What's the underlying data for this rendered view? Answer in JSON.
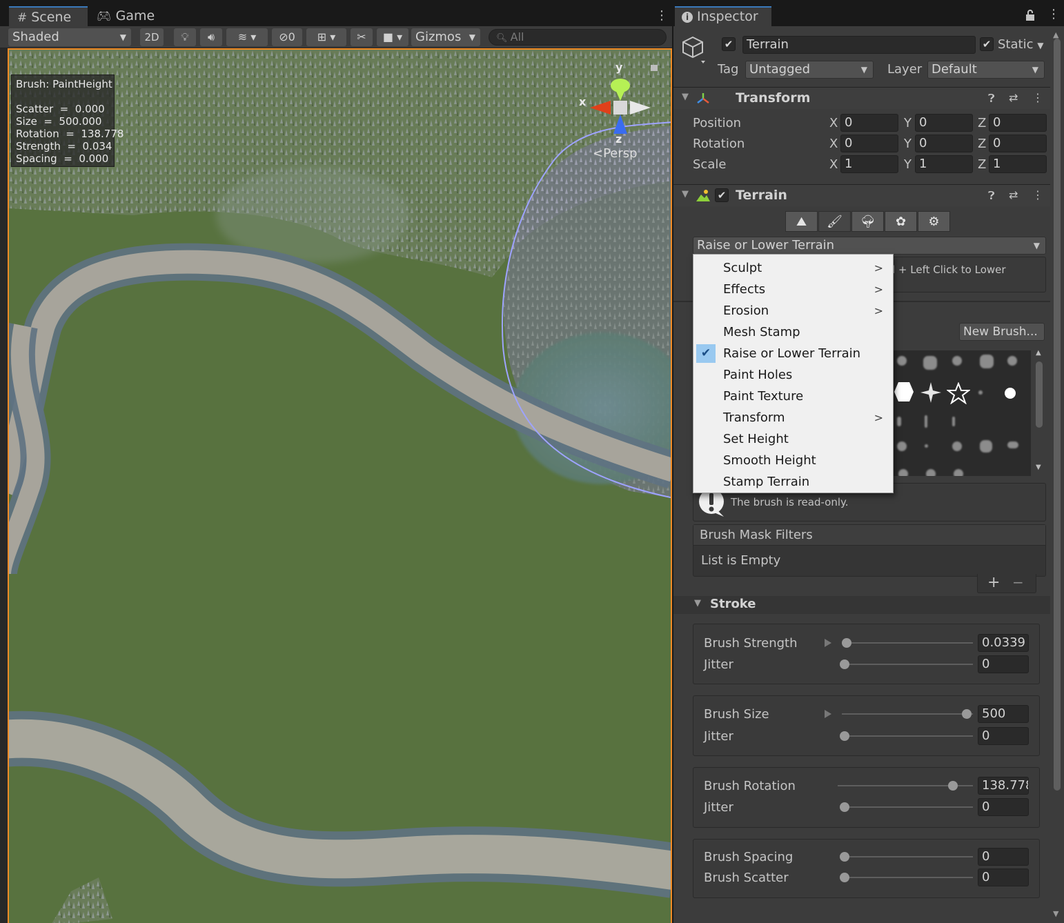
{
  "scene": {
    "tabs": {
      "scene_label": "Scene",
      "game_label": "Game"
    },
    "toolbar": {
      "shading_mode": "Shaded",
      "mode_2d": "2D",
      "hidden_count": "0",
      "gizmos_label": "Gizmos",
      "search_placeholder": "All"
    },
    "brush_overlay": {
      "brush": "Brush: PaintHeight",
      "scatter": "Scatter  =  0.000",
      "size": "Size  =  500.000",
      "rotation": "Rotation  =  138.778",
      "strength": "Strength  =  0.034",
      "spacing": "Spacing  =  0.000"
    },
    "gizmo": {
      "x": "x",
      "y": "y",
      "z": "z",
      "projection": "Persp"
    },
    "colors": {
      "selection_outline": "#f08a24",
      "grass": "#5b7646",
      "road": "#a7a49b",
      "water": "#607a82"
    }
  },
  "inspector": {
    "tab_label": "Inspector",
    "object": {
      "name": "Terrain",
      "active": true,
      "static_label": "Static",
      "static_checked": true,
      "tag_label": "Tag",
      "tag_value": "Untagged",
      "layer_label": "Layer",
      "layer_value": "Default"
    },
    "transform": {
      "title": "Transform",
      "rows": [
        {
          "label": "Position",
          "x": "0",
          "y": "0",
          "z": "0"
        },
        {
          "label": "Rotation",
          "x": "0",
          "y": "0",
          "z": "0"
        },
        {
          "label": "Scale",
          "x": "1",
          "y": "1",
          "z": "1"
        }
      ],
      "axis": {
        "x": "X",
        "y": "Y",
        "z": "Z"
      }
    },
    "terrain": {
      "title": "Terrain",
      "enabled": true,
      "tool_dropdown": "Raise or Lower Terrain",
      "help_text": "l + Left Click to Lower",
      "new_brush_label": "New Brush...",
      "brush_readonly": "The brush is read-only.",
      "mask_filters_title": "Brush Mask Filters",
      "mask_filters_empty": "List is Empty",
      "add_label": "+",
      "remove_label": "−"
    },
    "stroke": {
      "title": "Stroke",
      "brush_strength_label": "Brush Strength",
      "brush_strength_value": "0.0339",
      "brush_strength_fraction": 0.034,
      "strength_jitter_label": "Jitter",
      "strength_jitter_value": "0",
      "brush_size_label": "Brush Size",
      "brush_size_value": "500",
      "brush_size_fraction": 1.0,
      "size_jitter_label": "Jitter",
      "size_jitter_value": "0",
      "brush_rotation_label": "Brush Rotation",
      "brush_rotation_value": "138.778",
      "brush_rotation_fraction": 0.86,
      "rotation_jitter_label": "Jitter",
      "rotation_jitter_value": "0",
      "brush_spacing_label": "Brush Spacing",
      "brush_spacing_value": "0",
      "brush_scatter_label": "Brush Scatter",
      "brush_scatter_value": "0"
    }
  },
  "tool_menu": {
    "items": [
      {
        "label": "Sculpt",
        "has_submenu": true
      },
      {
        "label": "Effects",
        "has_submenu": true
      },
      {
        "label": "Erosion",
        "has_submenu": true
      },
      {
        "label": "Mesh Stamp",
        "has_submenu": false
      },
      {
        "label": "Raise or Lower Terrain",
        "has_submenu": false,
        "checked": true
      },
      {
        "label": "Paint Holes",
        "has_submenu": false
      },
      {
        "label": "Paint Texture",
        "has_submenu": false
      },
      {
        "label": "Transform",
        "has_submenu": true
      },
      {
        "label": "Set Height",
        "has_submenu": false
      },
      {
        "label": "Smooth Height",
        "has_submenu": false
      },
      {
        "label": "Stamp Terrain",
        "has_submenu": false
      }
    ],
    "check_color": "#99c9f0"
  }
}
